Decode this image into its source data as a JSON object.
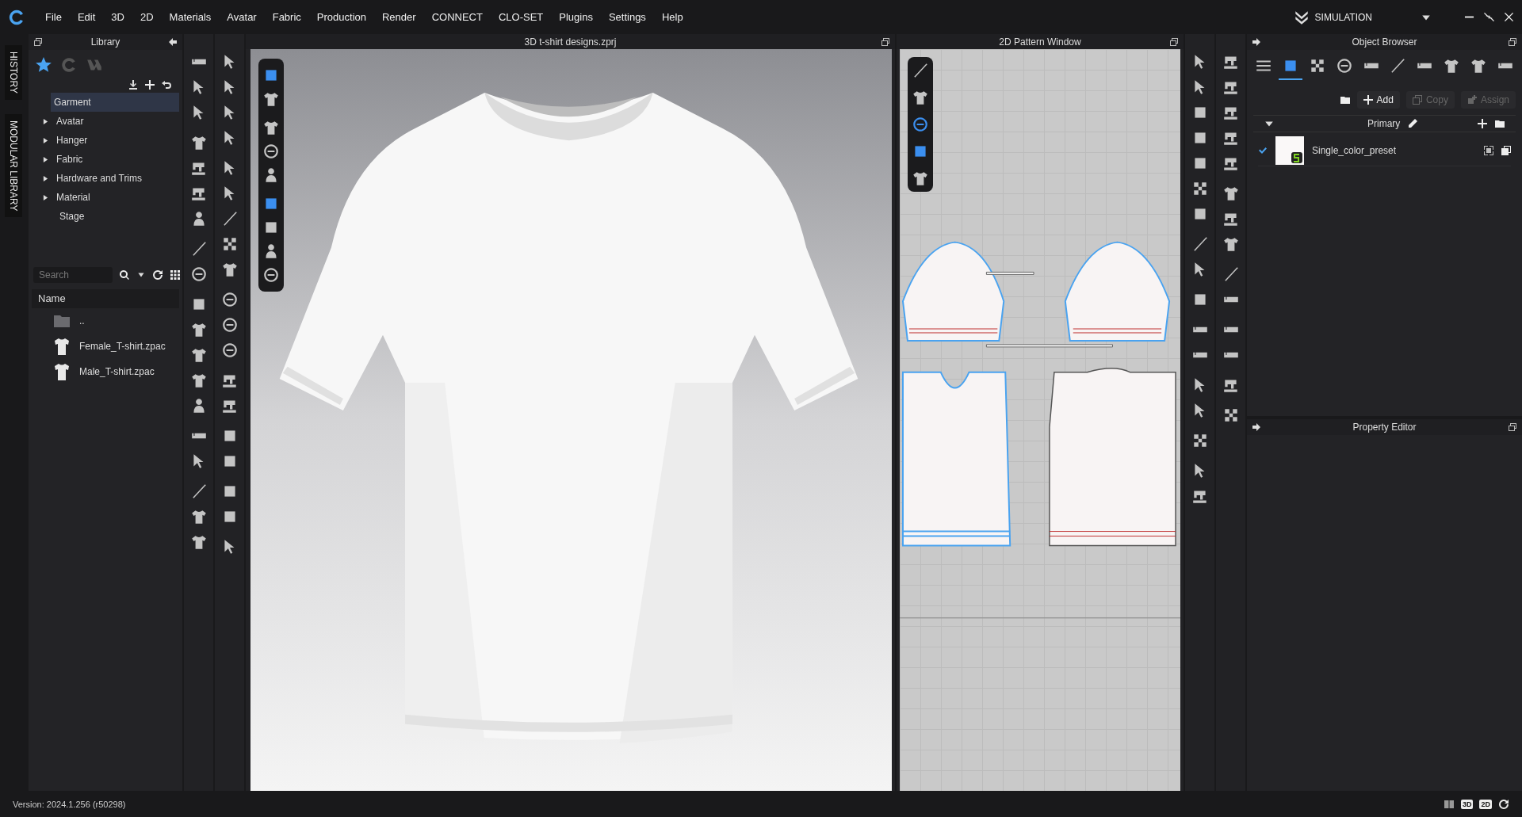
{
  "menu_bar": {
    "items": [
      "File",
      "Edit",
      "3D",
      "2D",
      "Materials",
      "Avatar",
      "Fabric",
      "Production",
      "Render",
      "CONNECT",
      "CLO-SET",
      "Plugins",
      "Settings",
      "Help"
    ],
    "mode": "SIMULATION"
  },
  "side_tabs": [
    "HISTORY",
    "MODULAR LIBRARY"
  ],
  "library": {
    "title": "Library",
    "sources": [
      {
        "selected": true
      },
      {
        "selected": false
      },
      {
        "selected": false
      }
    ],
    "tree": [
      {
        "label": "Garment",
        "expandable": false,
        "selected": true
      },
      {
        "label": "Avatar",
        "expandable": true,
        "selected": false
      },
      {
        "label": "Hanger",
        "expandable": true,
        "selected": false
      },
      {
        "label": "Fabric",
        "expandable": true,
        "selected": false
      },
      {
        "label": "Hardware and Trims",
        "expandable": true,
        "selected": false
      },
      {
        "label": "Material",
        "expandable": true,
        "selected": false
      },
      {
        "label": "Stage",
        "expandable": false,
        "selected": false
      }
    ],
    "search": {
      "placeholder": "Search"
    },
    "column": "Name",
    "files": [
      {
        "name": "..",
        "kind": "folder"
      },
      {
        "name": "Female_T-shirt.zpac",
        "kind": "garment"
      },
      {
        "name": "Male_T-shirt.zpac",
        "kind": "garment"
      }
    ]
  },
  "viewport_3d": {
    "title": "3D t-shirt designs.zprj"
  },
  "pattern_window": {
    "title": "2D Pattern Window"
  },
  "object_browser": {
    "title": "Object Browser",
    "tabs": [
      {
        "selected": false
      },
      {
        "selected": true
      },
      {
        "selected": false
      },
      {
        "selected": false
      },
      {
        "selected": false
      },
      {
        "selected": false
      },
      {
        "selected": false
      },
      {
        "selected": false
      },
      {
        "selected": false
      },
      {
        "selected": false
      }
    ],
    "actions": [
      {
        "label": "Add",
        "disabled": false
      },
      {
        "label": "Copy",
        "disabled": true
      },
      {
        "label": "Assign",
        "disabled": true
      }
    ],
    "group": {
      "label": "Primary",
      "expanded": true
    },
    "items": [
      {
        "name": "Single_color_preset",
        "checked": true
      }
    ]
  },
  "property_editor": {
    "title": "Property Editor"
  },
  "status_bar": {
    "version": "Version: 2024.1.256 (r50298)",
    "view_buttons": [
      "3D",
      "2D"
    ]
  }
}
